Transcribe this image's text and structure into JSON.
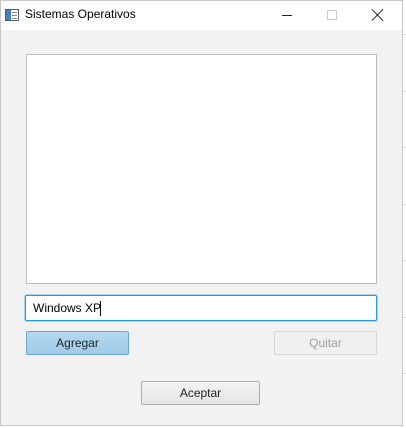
{
  "window": {
    "title": "Sistemas Operativos"
  },
  "input": {
    "value": "Windows XP"
  },
  "buttons": {
    "add_label": "Agregar",
    "remove_label": "Quitar",
    "accept_label": "Aceptar"
  },
  "list": {
    "items": []
  },
  "icons": {
    "app": "app-window-icon",
    "minimize": "minimize-icon",
    "maximize": "maximize-icon",
    "close": "close-icon"
  },
  "colors": {
    "focus_border": "#2b9bd6",
    "primary_button": "#b5d8f0",
    "window_background": "#f2f2f2"
  }
}
